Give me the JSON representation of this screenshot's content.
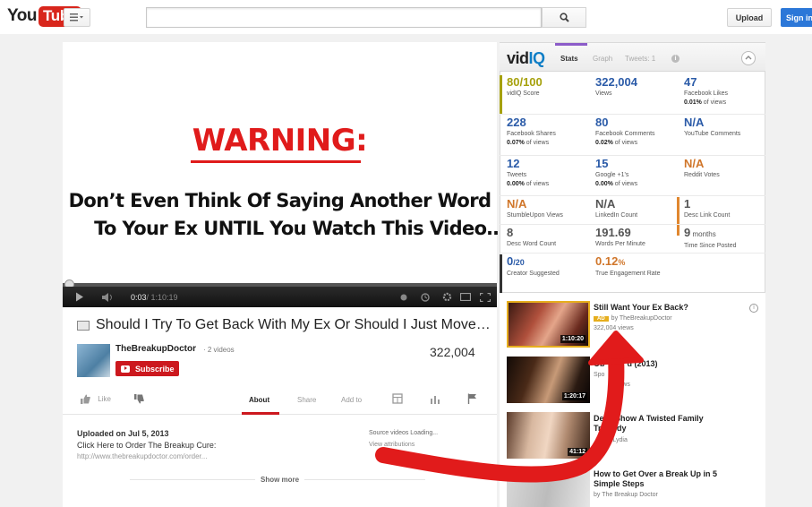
{
  "masthead": {
    "logo_you": "You",
    "logo_tube": "Tube",
    "upload_label": "Upload",
    "signin_label": "Sign in"
  },
  "player": {
    "warning": "WARNING:",
    "headline_line1": "Don’t Even Think Of Saying Another Word",
    "headline_line2": "To Your Ex UNTIL You Watch This Video…",
    "time_current": "0:03",
    "time_total": " / 1:10:19"
  },
  "video": {
    "title": "Should I Try To Get Back With My Ex Or Should I Just Move…",
    "channel": "TheBreakupDoctor",
    "channel_videos": "· 2 videos",
    "subscribe_label": "Subscribe",
    "views": "322,004"
  },
  "actions": {
    "like": "Like",
    "about": "About",
    "share": "Share",
    "add_to": "Add to"
  },
  "description": {
    "uploaded": "Uploaded on Jul 5, 2013",
    "order": "Click Here to Order The Breakup Cure:",
    "url": "http://www.thebreakupdoctor.com/order...",
    "source": "Source videos Loading...",
    "contributors": "View attributions",
    "show_more": "Show more"
  },
  "vidiq": {
    "logo_vid": "vid",
    "logo_iq": "IQ",
    "tabs": [
      "Stats",
      "Graph",
      "Tweets: 1"
    ],
    "info_icon": "i",
    "stats": [
      {
        "value": "80/100",
        "label": "vidIQ Score",
        "sub_strong": "",
        "sub": ""
      },
      {
        "value": "322,004",
        "label": "Views",
        "sub_strong": "",
        "sub": ""
      },
      {
        "value": "47",
        "label": "Facebook Likes",
        "sub_strong": "0.01%",
        "sub": " of views"
      },
      {
        "value": "228",
        "label": "Facebook Shares",
        "sub_strong": "0.07%",
        "sub": " of views"
      },
      {
        "value": "80",
        "label": "Facebook Comments",
        "sub_strong": "0.02%",
        "sub": " of views"
      },
      {
        "value": "N/A",
        "label": "YouTube Comments",
        "sub_strong": "",
        "sub": ""
      },
      {
        "value": "12",
        "label": "Tweets",
        "sub_strong": "0.00%",
        "sub": " of views"
      },
      {
        "value": "15",
        "label": "Google +1's",
        "sub_strong": "0.00%",
        "sub": " of views"
      },
      {
        "value": "N/A",
        "label": "Reddit Votes",
        "sub_strong": "",
        "sub": ""
      },
      {
        "value": "N/A",
        "label": "StumbleUpon Views",
        "sub_strong": "",
        "sub": ""
      },
      {
        "value": "N/A",
        "label": "LinkedIn Count",
        "sub_strong": "",
        "sub": ""
      },
      {
        "value": "1",
        "label": "Desc Link Count",
        "sub_strong": "",
        "sub": ""
      },
      {
        "value": "8",
        "label": "Desc Word Count",
        "sub_strong": "",
        "sub": ""
      },
      {
        "value": "191.69",
        "label": "Words Per Minute",
        "sub_strong": "",
        "sub": ""
      },
      {
        "value": "9",
        "value_unit": " months",
        "label": "Time Since Posted",
        "sub_strong": "",
        "sub": ""
      },
      {
        "value": "0",
        "value_unit": "/20",
        "label": "Creator Suggested",
        "sub_strong": "",
        "sub": ""
      },
      {
        "value": "0.12",
        "value_unit": "%",
        "label": "True Engagement Rate",
        "sub_strong": "",
        "sub": ""
      }
    ]
  },
  "related": {
    "info_icon": "i",
    "items": [
      {
        "title": "Still Want Your Ex Back?",
        "ad_label": "AD",
        "meta": "by TheBreakupDoctor",
        "views": "322,004 views",
        "duration": "1:10:20"
      },
      {
        "title": "Ob          d (2013)",
        "meta": "Spo",
        "views": "            views",
        "duration": "1:20:17"
      },
      {
        "title": "De     Show A Twisted Family",
        "title2": "Tr       dy",
        "meta": "           Lydia",
        "views": "",
        "duration": "41:12"
      },
      {
        "title": "How to Get Over a Break Up in 5",
        "title2": "Simple Steps",
        "meta": "by The Breakup Doctor",
        "views": "",
        "duration": ""
      }
    ]
  },
  "colors": {
    "youtube_red": "#d8261c",
    "warning_red": "#e01b1b",
    "subscribe_red": "#cc181e",
    "signin_blue": "#2b77d8",
    "vidiq_blue": "#0f7ec6",
    "score_olive": "#a6a10d",
    "stat_blue": "#2b5ba8",
    "stat_orange": "#d0762a",
    "arrow_red": "#e11b1b"
  }
}
